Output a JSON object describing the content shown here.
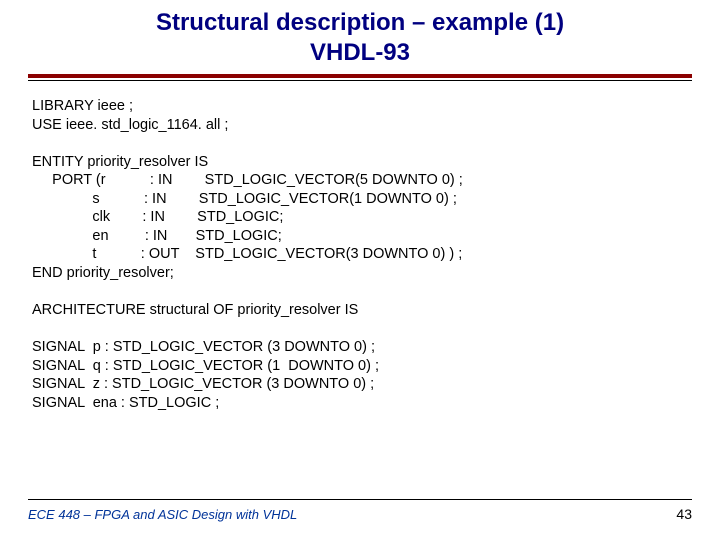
{
  "title_line1": "Structural description – example (1)",
  "title_line2": "VHDL-93",
  "code": "LIBRARY ieee ;\nUSE ieee. std_logic_1164. all ;\n\nENTITY priority_resolver IS\n     PORT (r           : IN        STD_LOGIC_VECTOR(5 DOWNTO 0) ;\n               s           : IN        STD_LOGIC_VECTOR(1 DOWNTO 0) ;\n               clk        : IN        STD_LOGIC;\n               en         : IN       STD_LOGIC;\n               t           : OUT    STD_LOGIC_VECTOR(3 DOWNTO 0) ) ;\nEND priority_resolver;\n\nARCHITECTURE structural OF priority_resolver IS\n\nSIGNAL  p : STD_LOGIC_VECTOR (3 DOWNTO 0) ;\nSIGNAL  q : STD_LOGIC_VECTOR (1  DOWNTO 0) ;\nSIGNAL  z : STD_LOGIC_VECTOR (3 DOWNTO 0) ;\nSIGNAL  ena : STD_LOGIC ;",
  "footer_left": "ECE 448 – FPGA and ASIC Design with VHDL",
  "footer_right": "43"
}
